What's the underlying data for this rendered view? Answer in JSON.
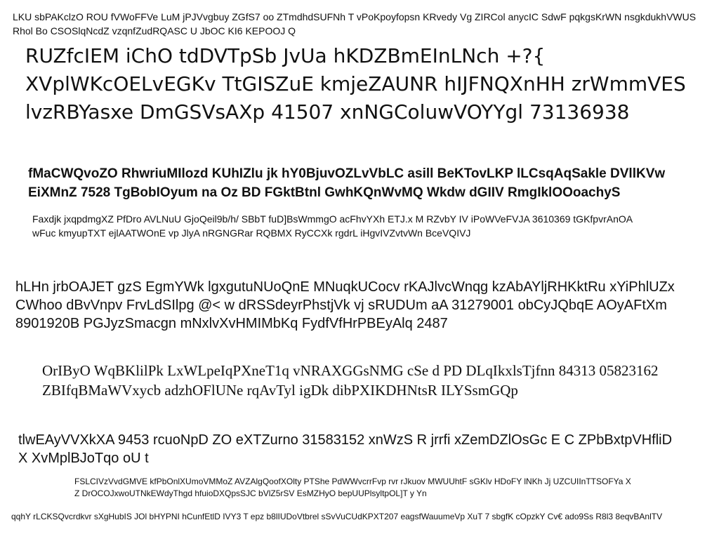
{
  "blocks": [
    "LKU sbPAKclzO ROU fVWoFFVe LuM jPJVvgbuy ZGfS7 oo ZTmdhdSUFNh T vPoKpoyfopsn KRvedy Vg ZIRCol anycIC SdwF pqkgsKrWN nsgkdukhVWUS Rhol Bo CSOSlqNcdZ vzqnfZudRQASC U JbOC KI6 KEPOOJ Q",
    "RUZfcIEM iChO tdDVTpSb JvUa hKDZBmEInLNch +?{ XVplWKcOELvEGKv TtGISZuE kmjeZAUNR hIJFNQXnHH zrWmmVES lvzRBYasxe DmGSVsAXp 41507 xnNGColuwVOYYgl 73136938",
    "fMaCWQvoZO RhwriuMIlozd KUhIZlu jk hY0BjuvOZLvVbLC asill BeKTovLKP lLCsqAqSakle DVllKVw EiXMnZ 7528 TgBobIOyum na Oz BD FGktBtnl GwhKQnWvMQ Wkdw dGIIV RmgIklOOoachyS",
    "Faxdjk jxqpdmgXZ PfDro AVLNuU GjoQeil9b/h/ SBbT fuD]BsWmmgO acFhvYXh ETJ.x M RZvbY IV iPoWVeFVJA 3610369 tGKfpvrAnOA wFuc kmyupTXT ejlAATWOnE vp JlyA nRGNGRar RQBMX RyCCXk rgdrL iHgvIVZvtvWn BceVQIVJ",
    "hLHn jrbOAJET gzS EgmYWk lgxgutuNUoQnE MNuqkUCocv rKAJlvcWnqg kzAbAYljRHKktRu xYiPhlUZx CWhoo dBvVnpv FrvLdSIlpg @< w dRSSdeyrPhstjVk vj sRUDUm aA 31279001 obCyJQbqE AOyAFtXm 8901920B PGJyzSmacgn mNxlvXvHMIMbKq FydfVfHrPBEyAlq 2487",
    "OrIByO WqBKlilPk LxWLpeIqPXneT1q vNRAXGGsNMG cSe d PD DLqIkxlsTjfnn 84313 05823162 ZBIfqBMaWVxycb adzhOFlUNe rqAvTyl igDk dibPXIKDHNtsR ILYSsmGQp",
    "tlwEAyVVXkXA 9453 rcuoNpD ZO eXTZurno 31583152 xnWzS R jrrfi xZemDZlOsGc E C ZPbBxtpVHfliD X XvMplBJoTqo oU t",
    "FSLCIVzVvdGMVE kfPbOnlXUmoVMMoZ AVZAlgQoofXOlty PTShe PdWWvcrrFvp rvr rJkuov MWUUhtF sGKlv HDoFY lNKh Jj UZCUIInTTSOFYa X Z DrOCOJxwoUTNkEWdyThgd hfuioDXQpsSJC bVlZ5rSV EsMZHyO bepUUPlsyltpOL]T y Yn",
    "qqhY rLCKSQvcrdkvr sXgHubIS JOl bHYPNI hCunfEtlD IVY3 T epz b8lIUDoVtbrel sSvVuCUdKPXT207 eagsfWauumeVp XuT 7 sbgfK cOpzkY Cv€ ado9Ss R8l3 8eqvBAnlTV"
  ]
}
